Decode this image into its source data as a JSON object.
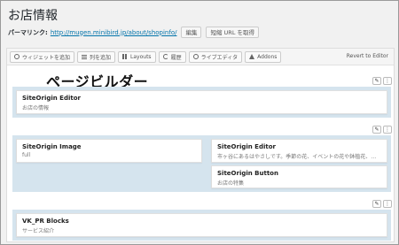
{
  "page": {
    "title": "お店情報"
  },
  "permalink": {
    "label": "パーマリンク:",
    "url": "http://mugen.minibird.jp/about/shopinfo/",
    "edit_label": "編集",
    "shortlink_label": "短縮 URL を取得"
  },
  "toolbar": {
    "buttons": [
      {
        "label": "ウィジェットを追加",
        "icon": "circle-plus-icon"
      },
      {
        "label": "列を追加",
        "icon": "rows-icon"
      },
      {
        "label": "Layouts",
        "icon": "layouts-icon"
      },
      {
        "label": "履歴",
        "icon": "history-icon"
      },
      {
        "label": "ライブエディタ",
        "icon": "eye-icon"
      },
      {
        "label": "Addons",
        "icon": "rocket-icon"
      }
    ],
    "revert_label": "Revert to Editor"
  },
  "builder_heading": "ページビルダー",
  "rows": [
    {
      "widgets": [
        {
          "title": "SiteOrigin Editor",
          "desc": "お店の情報"
        }
      ]
    },
    {
      "left": [
        {
          "title": "SiteOrigin Image",
          "desc": "full"
        }
      ],
      "right": [
        {
          "title": "SiteOrigin Editor",
          "desc": "市ヶ谷にあるはやさしです。季節の花、イベントの花や鉢植花、観葉植物など"
        },
        {
          "title": "SiteOrigin Button",
          "desc": "お店の特集"
        }
      ]
    },
    {
      "widgets": [
        {
          "title": "VK_PR Blocks",
          "desc": "サービス紹介"
        }
      ]
    }
  ],
  "row_tool_glyphs": {
    "wrench": "✎",
    "menu": "⋮"
  }
}
